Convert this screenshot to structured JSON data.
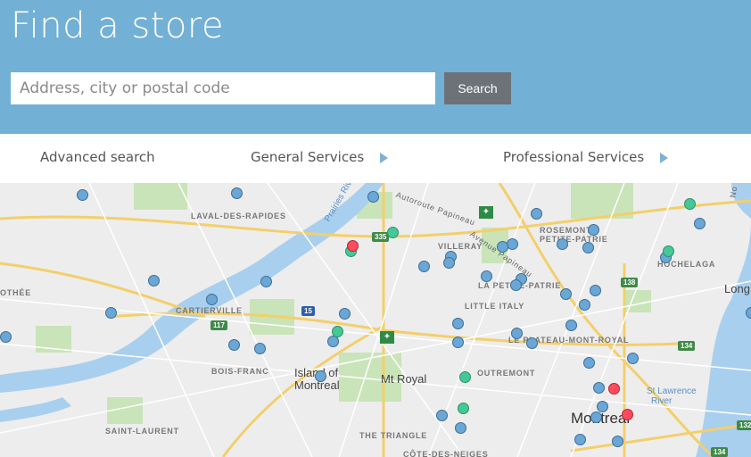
{
  "header": {
    "title": "Find a store",
    "search_placeholder": "Address, city or postal code",
    "search_button": "Search"
  },
  "nav": {
    "advanced": "Advanced search",
    "general": "General Services",
    "professional": "Professional Services"
  },
  "map": {
    "labels": {
      "laval": "LAVAL-DES-RAPIDES",
      "cartierville": "CARTIERVILLE",
      "boisfranc": "BOIS-FRANC",
      "saintlaurent": "SAINT-LAURENT",
      "island": "Island of",
      "montreal_island": "Montreal",
      "montroyal": "Mt Royal",
      "triangle": "THE TRIANGLE",
      "cotedesneiges": "CÔTE-DES-NEIGES",
      "villeray": "VILLERAY",
      "rosemont1": "ROSEMONT-",
      "rosemont2": "PETITE-PATRIE",
      "lapetite": "LA PETITE-PATRIE",
      "littleitaly": "LITTLE ITALY",
      "plateau": "LE PLATEAU-MONT-ROYAL",
      "outremont": "OUTREMONT",
      "hochelaga": "HOCHELAGA",
      "montreal": "Montreal",
      "stlawrence1": "St Lawrence",
      "stlawrence2": "River",
      "longueuil": "Long",
      "othee": "OTHÉE",
      "prairies": "Prairies River",
      "papineau": "Autoroute Papineau",
      "avenue": "Avenue Papineau",
      "no": "No"
    },
    "shields": [
      "335",
      "15",
      "117",
      "138",
      "134",
      "132",
      "134"
    ],
    "colors": {
      "store": "#6aa6d6",
      "green_store": "#44c896",
      "red_store": "#ff4b5c",
      "water": "#a9cfee",
      "park": "#c6e3b4",
      "road": "#f6d27a"
    }
  }
}
